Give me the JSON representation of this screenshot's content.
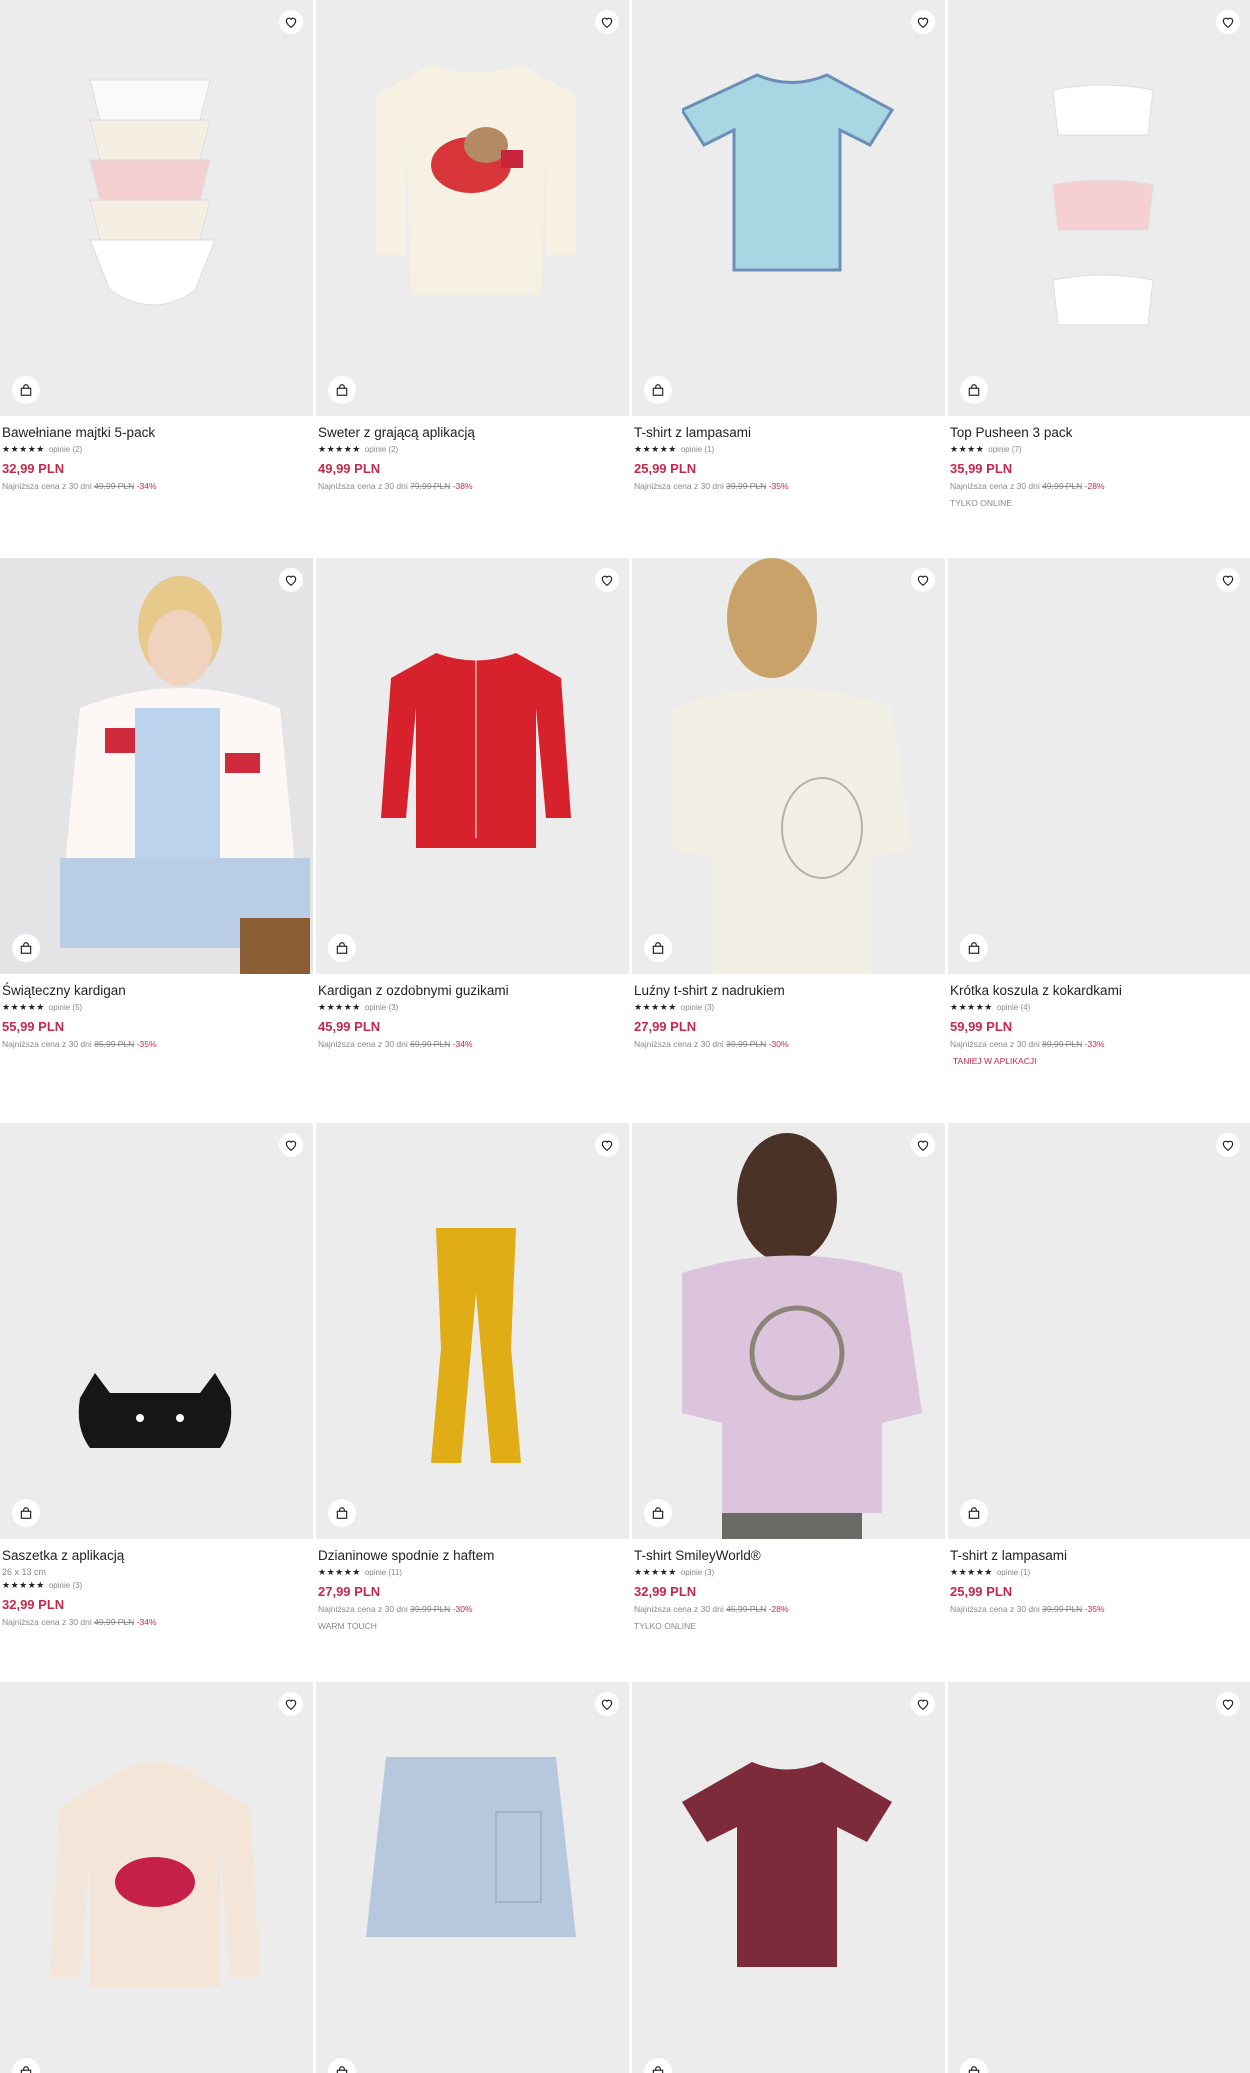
{
  "products": [
    {
      "title": "Bawełniane majtki 5-pack",
      "stars": "★★★★★",
      "reviews": "opinie (2)",
      "price": "32,99 PLN",
      "lowest_label": "Najniższa cena z 30 dni",
      "old_price": "49,99 PLN",
      "discount": "-34%",
      "tag": "",
      "size": ""
    },
    {
      "title": "Sweter z grającą aplikacją",
      "stars": "★★★★★",
      "reviews": "opinie (2)",
      "price": "49,99 PLN",
      "lowest_label": "Najniższa cena z 30 dni",
      "old_price": "79,99 PLN",
      "discount": "-38%",
      "tag": "",
      "size": ""
    },
    {
      "title": "T-shirt z lampasami",
      "stars": "★★★★★",
      "reviews": "opinie (1)",
      "price": "25,99 PLN",
      "lowest_label": "Najniższa cena z 30 dni",
      "old_price": "39,99 PLN",
      "discount": "-35%",
      "tag": "",
      "size": ""
    },
    {
      "title": "Top Pusheen 3 pack",
      "stars": "★★★★",
      "reviews": "opinie (7)",
      "price": "35,99 PLN",
      "lowest_label": "Najniższa cena z 30 dni",
      "old_price": "49,99 PLN",
      "discount": "-28%",
      "tag": "TYLKO ONLINE",
      "size": ""
    },
    {
      "title": "Świąteczny kardigan",
      "stars": "★★★★★",
      "reviews": "opinie (5)",
      "price": "55,99 PLN",
      "lowest_label": "Najniższa cena z 30 dni",
      "old_price": "85,99 PLN",
      "discount": "-35%",
      "tag": "",
      "size": ""
    },
    {
      "title": "Kardigan z ozdobnymi guzikami",
      "stars": "★★★★★",
      "reviews": "opinie (3)",
      "price": "45,99 PLN",
      "lowest_label": "Najniższa cena z 30 dni",
      "old_price": "69,99 PLN",
      "discount": "-34%",
      "tag": "",
      "size": ""
    },
    {
      "title": "Luźny t-shirt z nadrukiem",
      "stars": "★★★★★",
      "reviews": "opinie (3)",
      "price": "27,99 PLN",
      "lowest_label": "Najniższa cena z 30 dni",
      "old_price": "39,99 PLN",
      "discount": "-30%",
      "tag": "",
      "size": ""
    },
    {
      "title": "Krótka koszula z kokardkami",
      "stars": "★★★★★",
      "reviews": "opinie (4)",
      "price": "59,99 PLN",
      "lowest_label": "Najniższa cena z 30 dni",
      "old_price": "89,99 PLN",
      "discount": "-33%",
      "tag": "TANIEJ W APLIKACJI",
      "size": ""
    },
    {
      "title": "Saszetka z aplikacją",
      "stars": "★★★★★",
      "reviews": "opinie (3)",
      "price": "32,99 PLN",
      "lowest_label": "Najniższa cena z 30 dni",
      "old_price": "49,99 PLN",
      "discount": "-34%",
      "tag": "",
      "size": "26 x 13 cm"
    },
    {
      "title": "Dzianinowe spodnie z haftem",
      "stars": "★★★★★",
      "reviews": "opinie (11)",
      "price": "27,99 PLN",
      "lowest_label": "Najniższa cena z 30 dni",
      "old_price": "39,99 PLN",
      "discount": "-30%",
      "tag": "WARM TOUCH",
      "size": ""
    },
    {
      "title": "T-shirt SmileyWorld®",
      "stars": "★★★★★",
      "reviews": "opinie (3)",
      "price": "32,99 PLN",
      "lowest_label": "Najniższa cena z 30 dni",
      "old_price": "45,99 PLN",
      "discount": "-28%",
      "tag": "TYLKO ONLINE",
      "size": ""
    },
    {
      "title": "T-shirt z lampasami",
      "stars": "★★★★★",
      "reviews": "opinie (1)",
      "price": "25,99 PLN",
      "lowest_label": "Najniższa cena z 30 dni",
      "old_price": "39,99 PLN",
      "discount": "-35%",
      "tag": "",
      "size": ""
    },
    {
      "title": "",
      "stars": "",
      "reviews": "",
      "price": "",
      "lowest_label": "",
      "old_price": "",
      "discount": "",
      "tag": "",
      "size": ""
    },
    {
      "title": "",
      "stars": "",
      "reviews": "",
      "price": "",
      "lowest_label": "",
      "old_price": "",
      "discount": "",
      "tag": "",
      "size": ""
    },
    {
      "title": "",
      "stars": "",
      "reviews": "",
      "price": "",
      "lowest_label": "",
      "old_price": "",
      "discount": "",
      "tag": "",
      "size": ""
    },
    {
      "title": "",
      "stars": "",
      "reviews": "",
      "price": "",
      "lowest_label": "",
      "old_price": "",
      "discount": "",
      "tag": "",
      "size": ""
    }
  ],
  "colors": {
    "accent": "#c5284c",
    "image_bg": "#ececec"
  },
  "icons": {
    "favorite": "heart-icon",
    "add_to_cart": "shopping-bag-icon"
  }
}
